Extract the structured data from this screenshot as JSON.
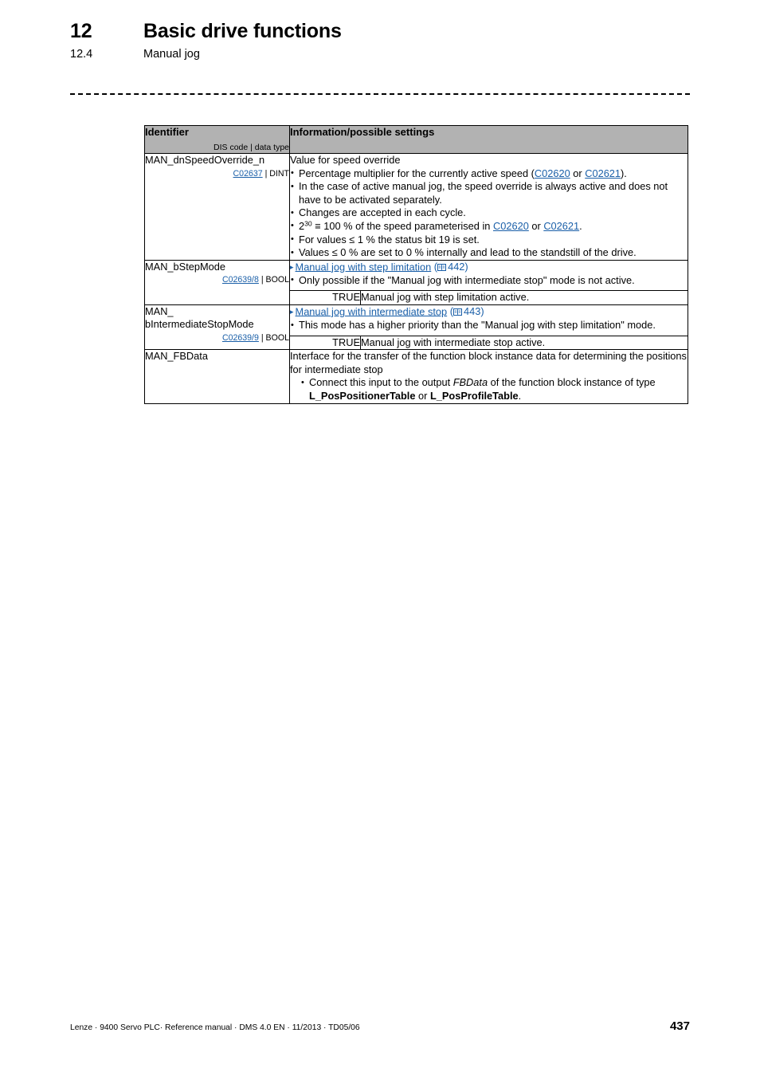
{
  "header": {
    "chapter_number": "12",
    "chapter_title": "Basic drive functions",
    "section_number": "12.4",
    "section_title": "Manual jog"
  },
  "table": {
    "columns": {
      "identifier_label": "Identifier",
      "identifier_sub": "DIS code | data type",
      "info_label": "Information/possible settings"
    },
    "rows": [
      {
        "id_name": "MAN_dnSpeedOverride_n",
        "dis_code": "C02637",
        "meta_sep": " | ",
        "data_type": "DINT",
        "lead": "Value for speed override",
        "bullets": [
          {
            "segments": [
              {
                "t": "Percentage multiplier for the currently active speed ("
              },
              {
                "t": "C02620",
                "link": true
              },
              {
                "t": " or "
              },
              {
                "t": "C02621",
                "link": true
              },
              {
                "t": ")."
              }
            ]
          },
          {
            "segments": [
              {
                "t": "In the case of active manual jog, the speed override is always active and does not have to be activated separately."
              }
            ]
          },
          {
            "segments": [
              {
                "t": "Changes are accepted in each cycle."
              }
            ]
          },
          {
            "segments": [
              {
                "t": "2"
              },
              {
                "t": "30",
                "sup": true
              },
              {
                "t": " ≡ 100 % of the speed parameterised in "
              },
              {
                "t": "C02620",
                "link": true
              },
              {
                "t": " or "
              },
              {
                "t": "C02621",
                "link": true
              },
              {
                "t": "."
              }
            ]
          },
          {
            "segments": [
              {
                "t": "For values ≤ 1 % the status bit 19 is set."
              }
            ]
          },
          {
            "segments": [
              {
                "t": "Values ≤ 0 % are set to 0 % internally and lead to the standstill of the drive."
              }
            ]
          }
        ],
        "xref": null,
        "true_row": null
      },
      {
        "id_name": "MAN_bStepMode",
        "dis_code": "C02639/8",
        "meta_sep": " | ",
        "data_type": "BOOL",
        "lead": null,
        "xref": {
          "triangle": "▸",
          "text": "Manual jog with step limitation",
          "page": "442"
        },
        "bullets": [
          {
            "segments": [
              {
                "t": "Only possible if the \"Manual jog with intermediate stop\" mode is not active."
              }
            ]
          }
        ],
        "true_row": {
          "label": "TRUE",
          "description": "Manual jog with step limitation active."
        }
      },
      {
        "id_name": "MAN_\nbIntermediateStopMode",
        "id_line1": "MAN_",
        "id_line2": "bIntermediateStopMode",
        "dis_code": "C02639/9",
        "meta_sep": " | ",
        "data_type": "BOOL",
        "lead": null,
        "xref": {
          "triangle": "▸",
          "text": "Manual jog with intermediate stop",
          "page": "443"
        },
        "bullets": [
          {
            "segments": [
              {
                "t": "This mode has a higher priority than the \"Manual jog with step limitation\" mode."
              }
            ]
          }
        ],
        "true_row": {
          "label": "TRUE",
          "description": "Manual jog with intermediate stop active."
        }
      },
      {
        "id_name": "MAN_FBData",
        "dis_code": null,
        "meta_sep": null,
        "data_type": null,
        "lead": "Interface for the transfer of the function block instance data for determining the positions for intermediate stop",
        "xref": null,
        "bullets_indented": true,
        "bullets": [
          {
            "segments": [
              {
                "t": "Connect this input to the output "
              },
              {
                "t": "FBData",
                "italic": true
              },
              {
                "t": " of the function block instance of type "
              },
              {
                "t": "L_PosPositionerTable",
                "bold": true
              },
              {
                "t": " or "
              },
              {
                "t": "L_PosProfileTable",
                "bold": true
              },
              {
                "t": "."
              }
            ]
          }
        ],
        "true_row": null
      }
    ]
  },
  "footer": {
    "text": "Lenze · 9400 Servo PLC· Reference manual · DMS 4.0 EN · 11/2013 · TD05/06",
    "page_number": "437"
  },
  "colors": {
    "link": "#1a5fa8",
    "table_header_bg": "#b2b2b2",
    "border": "#000000"
  }
}
